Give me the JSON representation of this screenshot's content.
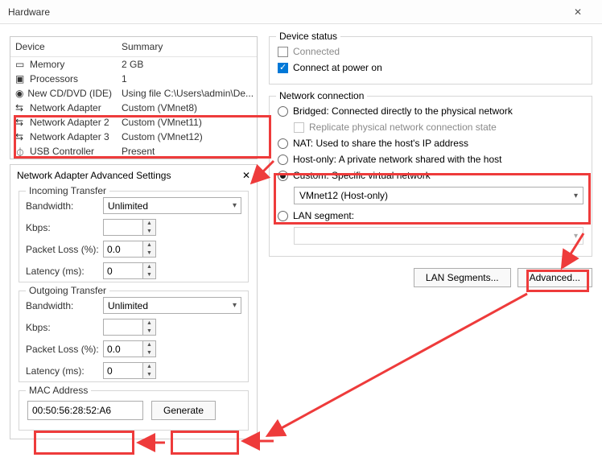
{
  "window": {
    "title": "Hardware"
  },
  "device_table": {
    "head": {
      "c1": "Device",
      "c2": "Summary"
    },
    "rows": [
      {
        "name": "Memory",
        "summary": "2 GB"
      },
      {
        "name": "Processors",
        "summary": "1"
      },
      {
        "name": "New CD/DVD (IDE)",
        "summary": "Using file C:\\Users\\admin\\De..."
      },
      {
        "name": "Network Adapter",
        "summary": "Custom (VMnet8)"
      },
      {
        "name": "Network Adapter 2",
        "summary": "Custom (VMnet11)"
      },
      {
        "name": "Network Adapter 3",
        "summary": "Custom (VMnet12)"
      },
      {
        "name": "USB Controller",
        "summary": "Present"
      }
    ]
  },
  "adv": {
    "title": "Network Adapter Advanced Settings",
    "incoming": {
      "title": "Incoming Transfer",
      "bandwidth_label": "Bandwidth:",
      "bandwidth_value": "Unlimited",
      "kbps_label": "Kbps:",
      "kbps_value": "",
      "loss_label": "Packet Loss (%):",
      "loss_value": "0.0",
      "lat_label": "Latency (ms):",
      "lat_value": "0"
    },
    "outgoing": {
      "title": "Outgoing Transfer",
      "bandwidth_label": "Bandwidth:",
      "bandwidth_value": "Unlimited",
      "kbps_label": "Kbps:",
      "kbps_value": "",
      "loss_label": "Packet Loss (%):",
      "loss_value": "0.0",
      "lat_label": "Latency (ms):",
      "lat_value": "0"
    },
    "mac": {
      "title": "MAC Address",
      "value": "00:50:56:28:52:A6",
      "generate": "Generate"
    }
  },
  "right": {
    "status": {
      "title": "Device status",
      "connected": "Connected",
      "poweron": "Connect at power on"
    },
    "netconn": {
      "title": "Network connection",
      "bridged": "Bridged: Connected directly to the physical network",
      "replicate": "Replicate physical network connection state",
      "nat": "NAT: Used to share the host's IP address",
      "hostonly": "Host-only: A private network shared with the host",
      "custom": "Custom: Specific virtual network",
      "custom_value": "VMnet12 (Host-only)",
      "lanseg": "LAN segment:"
    },
    "buttons": {
      "lanseg": "LAN Segments...",
      "advanced": "Advanced..."
    }
  }
}
